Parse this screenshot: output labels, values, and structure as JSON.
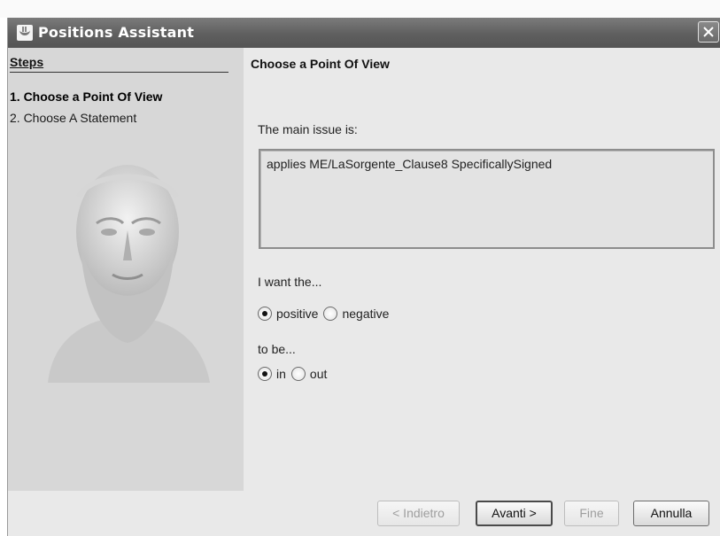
{
  "window": {
    "title": "Positions Assistant"
  },
  "steps": {
    "header": "Steps",
    "items": [
      {
        "label": "1. Choose a Point Of View",
        "active": true
      },
      {
        "label": "2. Choose A Statement",
        "active": false
      }
    ]
  },
  "main": {
    "title": "Choose a Point Of View",
    "issue_label": "The main issue is:",
    "issue_text": "applies ME/LaSorgente_Clause8 SpecificallySigned",
    "want_label": "I want the...",
    "polarity": {
      "options": [
        "positive",
        "negative"
      ],
      "selected": "positive"
    },
    "tobe_label": "to be...",
    "status": {
      "options": [
        "in",
        "out"
      ],
      "selected": "in"
    }
  },
  "buttons": {
    "back": "< Indietro",
    "next": "Avanti >",
    "finish": "Fine",
    "cancel": "Annulla"
  },
  "icons": {
    "app": "java-cup-icon",
    "close": "close-icon"
  }
}
